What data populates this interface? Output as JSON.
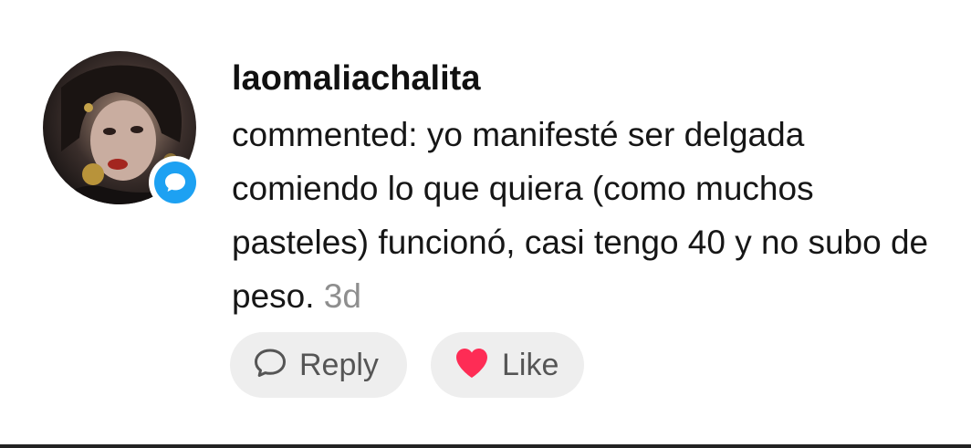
{
  "notification": {
    "username": "laomaliachalita",
    "comment_text": "commented: yo manifesté ser delgada comiendo lo que quiera (como muchos pasteles) funcionó, casi tengo 40 y no subo de peso.",
    "timestamp": "3d",
    "badge_icon": "comment-bubble-icon",
    "badge_color": "#1da1f2"
  },
  "actions": {
    "reply_label": "Reply",
    "reply_icon": "speech-bubble-icon",
    "like_label": "Like",
    "like_icon": "heart-icon",
    "like_color": "#fe2c55"
  }
}
